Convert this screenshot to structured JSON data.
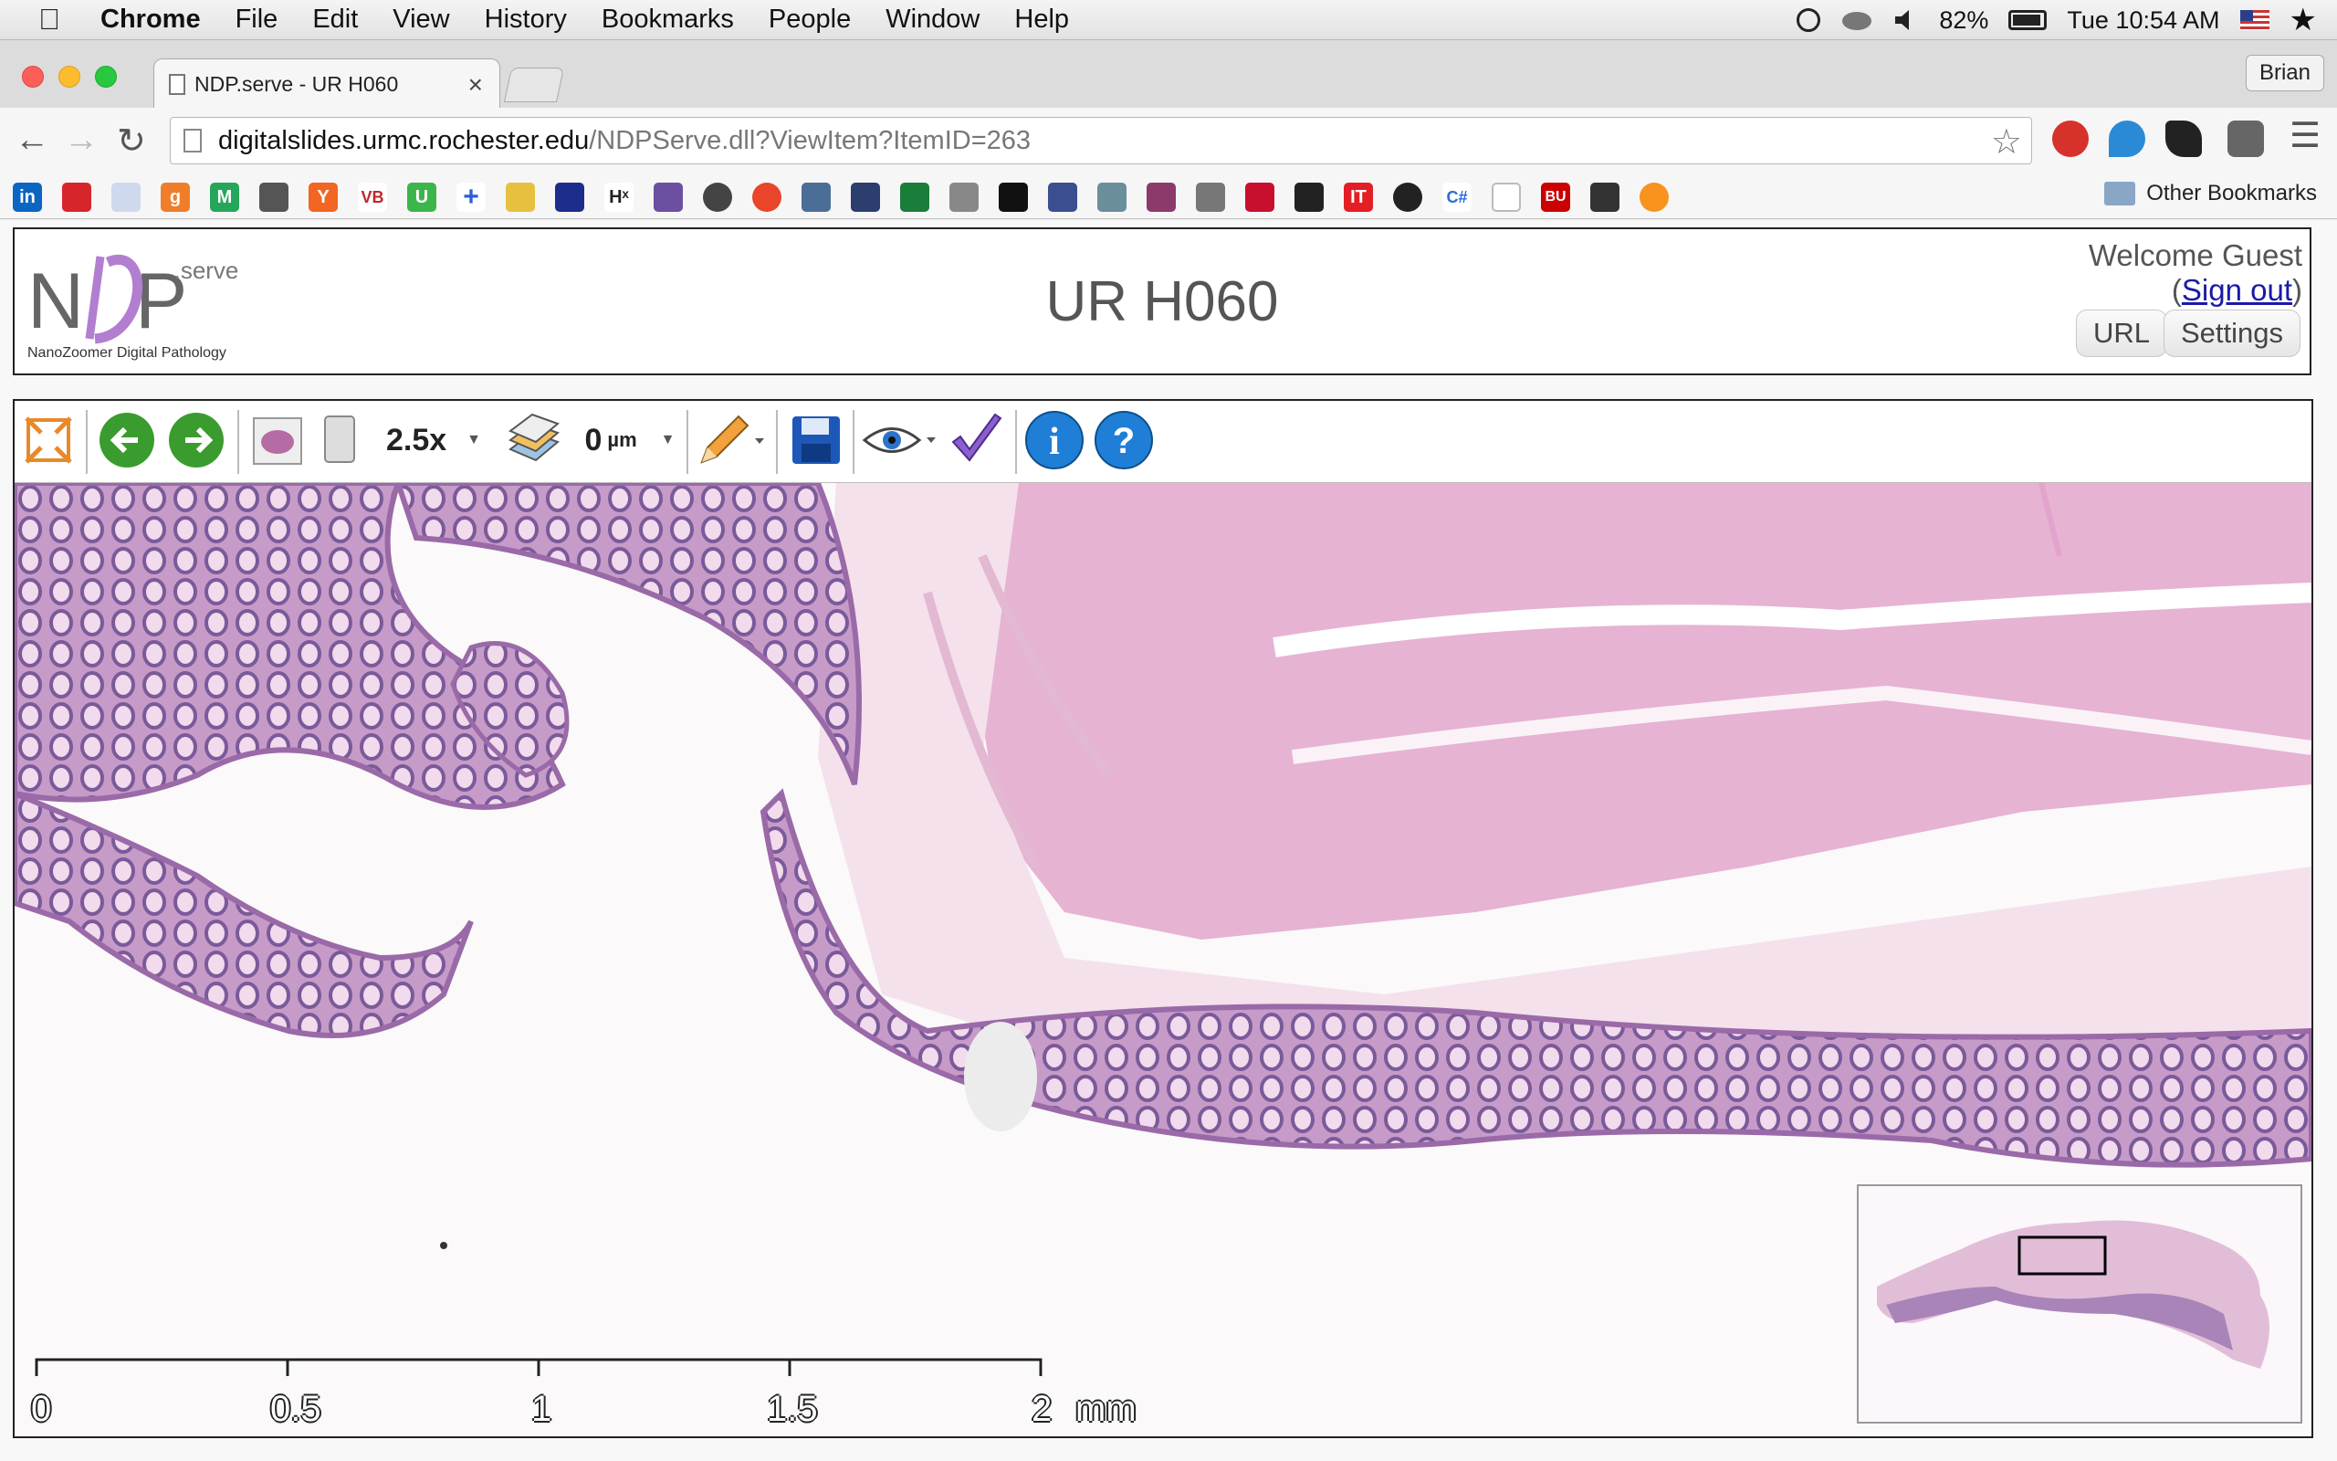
{
  "menubar": {
    "app": "Chrome",
    "items": [
      "File",
      "Edit",
      "View",
      "History",
      "Bookmarks",
      "People",
      "Window",
      "Help"
    ],
    "battery": "82%",
    "clock": "Tue 10:54 AM"
  },
  "browser": {
    "tab_title": "NDP.serve - UR H060",
    "tab_close": "×",
    "profile": "Brian",
    "url_host": "digitalslides.urmc.rochester.edu",
    "url_path": "/NDPServe.dll?ViewItem?ItemID=263",
    "other_bookmarks": "Other Bookmarks"
  },
  "header": {
    "logo_sub": "NanoZoomer Digital Pathology",
    "logo_serve": ".serve",
    "title": "UR H060",
    "welcome": "Welcome Guest",
    "sign_out": "Sign out",
    "url_button": "URL",
    "settings_button": "Settings"
  },
  "viewer": {
    "magnification": "2.5x",
    "focus_value": "0",
    "focus_unit": "µm",
    "scale_labels": [
      "0",
      "0.5",
      "1",
      "1.5",
      "2"
    ],
    "scale_unit": "mm"
  },
  "colors": {
    "tissue_pink": "#e7b3d4",
    "tissue_purple": "#a67fb3",
    "logo_purple": "#b27ecf",
    "nav_green": "#3a9c2e",
    "info_blue": "#1f7fd6"
  }
}
